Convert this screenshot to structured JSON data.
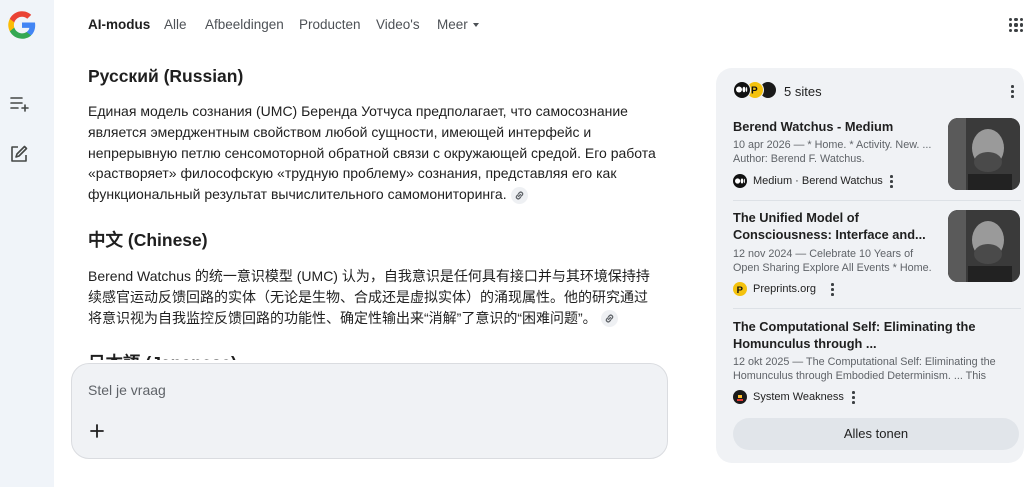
{
  "nav": {
    "tabs": [
      {
        "label": "AI-modus",
        "active": true
      },
      {
        "label": "Alle"
      },
      {
        "label": "Afbeeldingen"
      },
      {
        "label": "Producten"
      },
      {
        "label": "Video's"
      },
      {
        "label": "Meer"
      }
    ]
  },
  "sidebar": {
    "icons": [
      "new-thread-icon",
      "edit-icon"
    ]
  },
  "content": {
    "sections": [
      {
        "heading": "Русский (Russian)",
        "text": "Единая модель сознания (UMC) Беренда Уотчуса предполагает, что самосознание является эмерджентным свойством любой сущности, имеющей интерфейс и непрерывную петлю сенсомоторной обратной связи с окружающей средой. Его работа «растворяет» философскую «трудную проблему» сознания, представляя его как функциональный результат вычислительного самомониторинга."
      },
      {
        "heading": "中文 (Chinese)",
        "text": "Berend Watchus 的统一意识模型 (UMC) 认为，自我意识是任何具有接口并与其环境保持持续感官运动反馈回路的实体（无论是生物、合成还是虚拟实体）的涌现属性。他的研究通过将意识视为自我监控反馈回路的功能性、确定性输出来“消解”了意识的“困难问题”。"
      },
      {
        "heading": "日本語 (Japanese)",
        "text": ""
      }
    ]
  },
  "ask": {
    "placeholder": "Stel je vraag"
  },
  "sources": {
    "count_label": "5 sites",
    "items": [
      {
        "title": "Berend Watchus - Medium",
        "snippet": "10 apr 2026 — * Home. * Activity. New. ... Author: Berend F. Watchus. Independent...",
        "site": "Medium · Berend Watchus",
        "favicon": "medium-icon"
      },
      {
        "title": "The Unified Model of Consciousness: Interface and...",
        "snippet": "12 nov 2024 — Celebrate 10 Years of Open Sharing Explore All Events * Home. * ...",
        "site": "Preprints.org",
        "favicon": "preprints-icon"
      },
      {
        "title": "The Computational Self: Eliminating the Homunculus through ...",
        "snippet": "12 okt 2025 — The Computational Self: Eliminating the Homunculus through Embodied Determinism. ... This paper...",
        "site": "System Weakness",
        "favicon": "system-weakness-icon"
      }
    ],
    "show_all_label": "Alles tonen"
  },
  "colors": {
    "rail_bg": "#f0f4f9",
    "panel_bg": "#f0f2f5",
    "preprints_yellow": "#f4c20d"
  }
}
